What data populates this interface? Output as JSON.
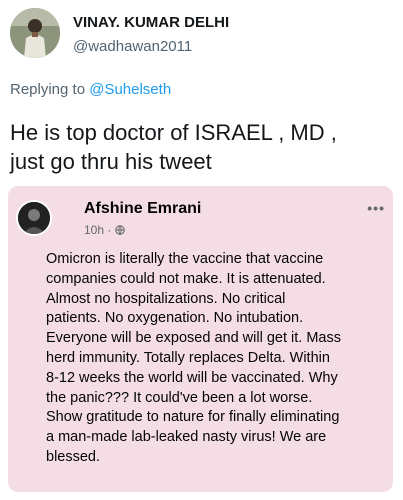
{
  "tweet": {
    "author_name": "VINAY. KUMAR DELHI",
    "author_handle": "@wadhawan2011",
    "replying_prefix": "Replying to",
    "replying_to": "@Suhelseth",
    "text_lines": [
      "He is top doctor of ISRAEL , MD ,",
      "just go thru his tweet"
    ]
  },
  "embedded_post": {
    "author_name": "Afshine Emrani",
    "time": "10h ·",
    "privacy_icon": "globe-icon",
    "more_icon": "more-dots-icon",
    "more_label": "•••",
    "body_lines": [
      "Omicron is literally the vaccine that vaccine",
      "companies could not make.  It is attenuated.",
      "Almost no hospitalizations.  No critical",
      "patients.  No oxygenation.  No intubation.",
      "Everyone will be exposed and will get it.  Mass",
      "herd immunity.  Totally replaces Delta.  Within",
      "8-12 weeks the world will be vaccinated.  Why",
      "the panic???  It could've been a lot worse.",
      "Show gratitude to nature for finally eliminating",
      "a man-made lab-leaked nasty virus!  We are",
      "blessed."
    ]
  },
  "colors": {
    "link": "#1d9bf0",
    "secondary_text": "#536471",
    "card_background": "#f4dde4"
  }
}
